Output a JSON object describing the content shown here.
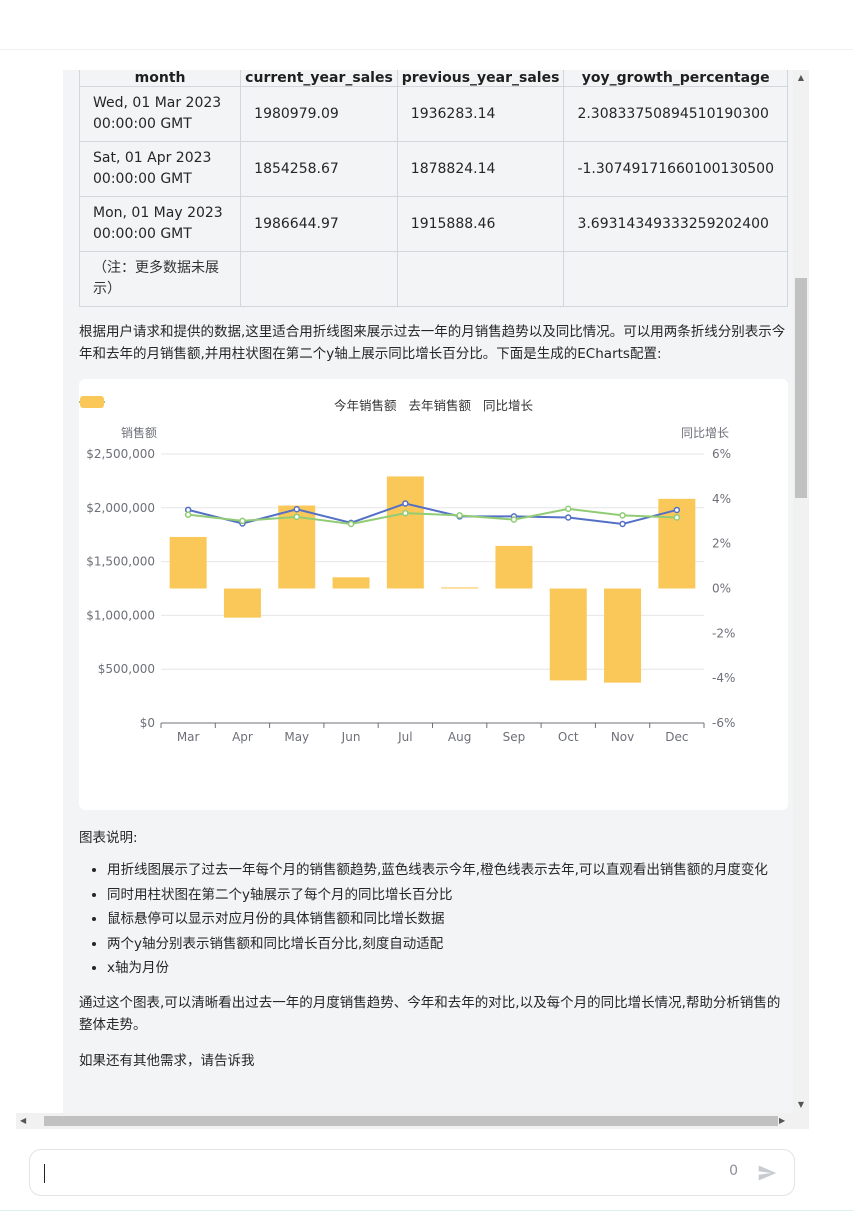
{
  "table": {
    "headers": [
      "month",
      "current_year_sales",
      "previous_year_sales",
      "yoy_growth_percentage"
    ],
    "rows": [
      [
        "Wed, 01 Mar 2023 00:00:00 GMT",
        "1980979.09",
        "1936283.14",
        "2.30833750894510190300"
      ],
      [
        "Sat, 01 Apr 2023 00:00:00 GMT",
        "1854258.67",
        "1878824.14",
        "-1.30749171660100130500"
      ],
      [
        "Mon, 01 May 2023 00:00:00 GMT",
        "1986644.97",
        "1915888.46",
        "3.69314349333259202400"
      ],
      [
        "（注：更多数据未展示）",
        "",
        "",
        ""
      ]
    ]
  },
  "intro_text": "根据用户请求和提供的数据,这里适合用折线图来展示过去一年的月销售趋势以及同比情况。可以用两条折线分别表示今年和去年的月销售额,并用柱状图在第二个y轴上展示同比增长百分比。下面是生成的ECharts配置:",
  "chart_data": {
    "type": "bar",
    "legend_position": "top-center",
    "categories": [
      "Mar",
      "Apr",
      "May",
      "Jun",
      "Jul",
      "Aug",
      "Sep",
      "Oct",
      "Nov",
      "Dec"
    ],
    "y_left": {
      "label": "销售额",
      "ticks": [
        "$0",
        "$500,000",
        "$1,000,000",
        "$1,500,000",
        "$2,000,000",
        "$2,500,000"
      ],
      "ylim": [
        0,
        2500000
      ]
    },
    "y_right": {
      "label": "同比增长",
      "ticks": [
        "-6%",
        "-4%",
        "-2%",
        "0%",
        "2%",
        "4%",
        "6%"
      ],
      "ylim": [
        -6,
        6
      ]
    },
    "series": [
      {
        "name": "今年销售额",
        "kind": "line",
        "axis": "left",
        "color": "#5470c6",
        "values": [
          1980979,
          1854259,
          1986645,
          1860000,
          2040000,
          1920000,
          1920000,
          1910000,
          1850000,
          1980000
        ]
      },
      {
        "name": "去年销售额",
        "kind": "line",
        "axis": "left",
        "color": "#91cc75",
        "values": [
          1936283,
          1878824,
          1915888,
          1850000,
          1950000,
          1930000,
          1890000,
          1990000,
          1930000,
          1910000
        ]
      },
      {
        "name": "同比增长",
        "kind": "bar",
        "axis": "right",
        "color": "#fac858",
        "values": [
          2.3,
          -1.3,
          3.7,
          0.5,
          5.0,
          0.05,
          1.9,
          -4.1,
          -4.2,
          4.0
        ]
      }
    ],
    "grid": true
  },
  "notes_title": "图表说明:",
  "notes": [
    "用折线图展示了过去一年每个月的销售额趋势,蓝色线表示今年,橙色线表示去年,可以直观看出销售额的月度变化",
    "同时用柱状图在第二个y轴展示了每个月的同比增长百分比",
    "鼠标悬停可以显示对应月份的具体销售额和同比增长数据",
    "两个y轴分别表示销售额和同比增长百分比,刻度自动适配",
    "x轴为月份"
  ],
  "summary_text": "通过这个图表,可以清晰看出过去一年的月度销售趋势、今年和去年的对比,以及每个月的同比增长情况,帮助分析销售的整体走势。",
  "closing_text": "如果还有其他需求，请告诉我",
  "input": {
    "counter": "0",
    "placeholder": ""
  },
  "icons": {
    "send": "send-icon"
  }
}
